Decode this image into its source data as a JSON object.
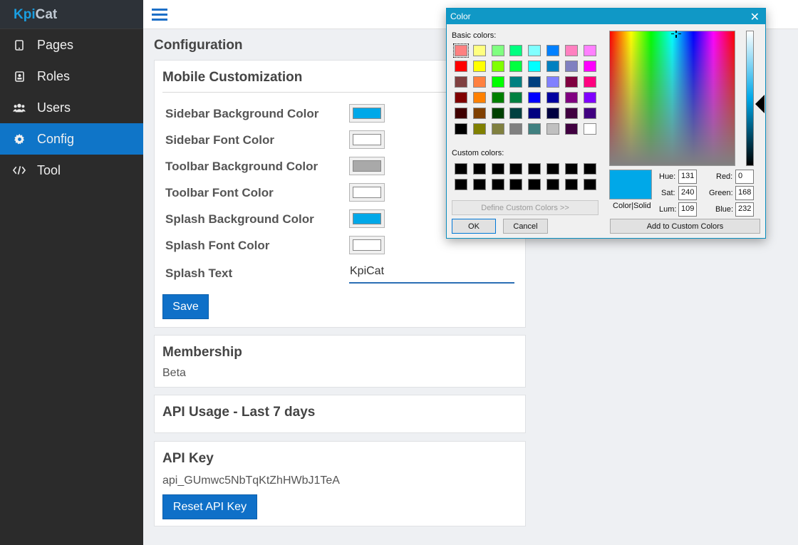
{
  "sidebar": {
    "brand_a": "Kpi",
    "brand_b": "Cat",
    "items": [
      {
        "label": "Pages",
        "icon": "tablet-icon"
      },
      {
        "label": "Roles",
        "icon": "id-badge-icon"
      },
      {
        "label": "Users",
        "icon": "users-icon"
      },
      {
        "label": "Config",
        "icon": "gear-icon",
        "active": true
      },
      {
        "label": "Tool",
        "icon": "code-icon"
      }
    ]
  },
  "page": {
    "title": "Configuration"
  },
  "mobile": {
    "title": "Mobile Customization",
    "rows": [
      {
        "label": "Sidebar Background Color",
        "color": "#00a8e8"
      },
      {
        "label": "Sidebar Font Color",
        "color": "#ffffff"
      },
      {
        "label": "Toolbar Background Color",
        "color": "#a9a9a9"
      },
      {
        "label": "Toolbar Font Color",
        "color": "#ffffff"
      },
      {
        "label": "Splash Background Color",
        "color": "#00a8e8"
      },
      {
        "label": "Splash Font Color",
        "color": "#ffffff"
      }
    ],
    "splash_text_label": "Splash Text",
    "splash_text_value": "KpiCat",
    "save_label": "Save"
  },
  "membership": {
    "title": "Membership",
    "value": "Beta"
  },
  "usage": {
    "title": "API Usage - Last 7 days"
  },
  "api_key": {
    "title": "API Key",
    "value": "api_GUmwc5NbTqKtZhHWbJ1TeA",
    "reset_label": "Reset API Key"
  },
  "dialog": {
    "title": "Color",
    "basic_label": "Basic colors:",
    "custom_label": "Custom colors:",
    "basic_colors": [
      [
        "#ff8080",
        "#ffff80",
        "#80ff80",
        "#00ff80",
        "#80ffff",
        "#0080ff",
        "#ff80c0",
        "#ff80ff"
      ],
      [
        "#ff0000",
        "#ffff00",
        "#80ff00",
        "#00ff40",
        "#00ffff",
        "#0080c0",
        "#8080c0",
        "#ff00ff"
      ],
      [
        "#804040",
        "#ff8040",
        "#00ff00",
        "#008080",
        "#004080",
        "#8080ff",
        "#800040",
        "#ff0080"
      ],
      [
        "#800000",
        "#ff8000",
        "#008000",
        "#008040",
        "#0000ff",
        "#0000a0",
        "#800080",
        "#8000ff"
      ],
      [
        "#400000",
        "#804000",
        "#004000",
        "#004040",
        "#000080",
        "#000040",
        "#400040",
        "#400080"
      ],
      [
        "#000000",
        "#808000",
        "#808040",
        "#808080",
        "#408080",
        "#c0c0c0",
        "#400040",
        "#ffffff"
      ]
    ],
    "custom_colors": [
      [
        "#000000",
        "#000000",
        "#000000",
        "#000000",
        "#000000",
        "#000000",
        "#000000",
        "#000000"
      ],
      [
        "#000000",
        "#000000",
        "#000000",
        "#000000",
        "#000000",
        "#000000",
        "#000000",
        "#000000"
      ]
    ],
    "preview_color": "#00a8e8",
    "color_solid_label": "Color|Solid",
    "hue_label": "Hue:",
    "hue": "131",
    "sat_label": "Sat:",
    "sat": "240",
    "lum_label": "Lum:",
    "lum": "109",
    "red_label": "Red:",
    "red": "0",
    "green_label": "Green:",
    "green": "168",
    "blue_label": "Blue:",
    "blue": "232",
    "define_label": "Define Custom Colors >>",
    "ok_label": "OK",
    "cancel_label": "Cancel",
    "add_label": "Add to Custom Colors"
  }
}
